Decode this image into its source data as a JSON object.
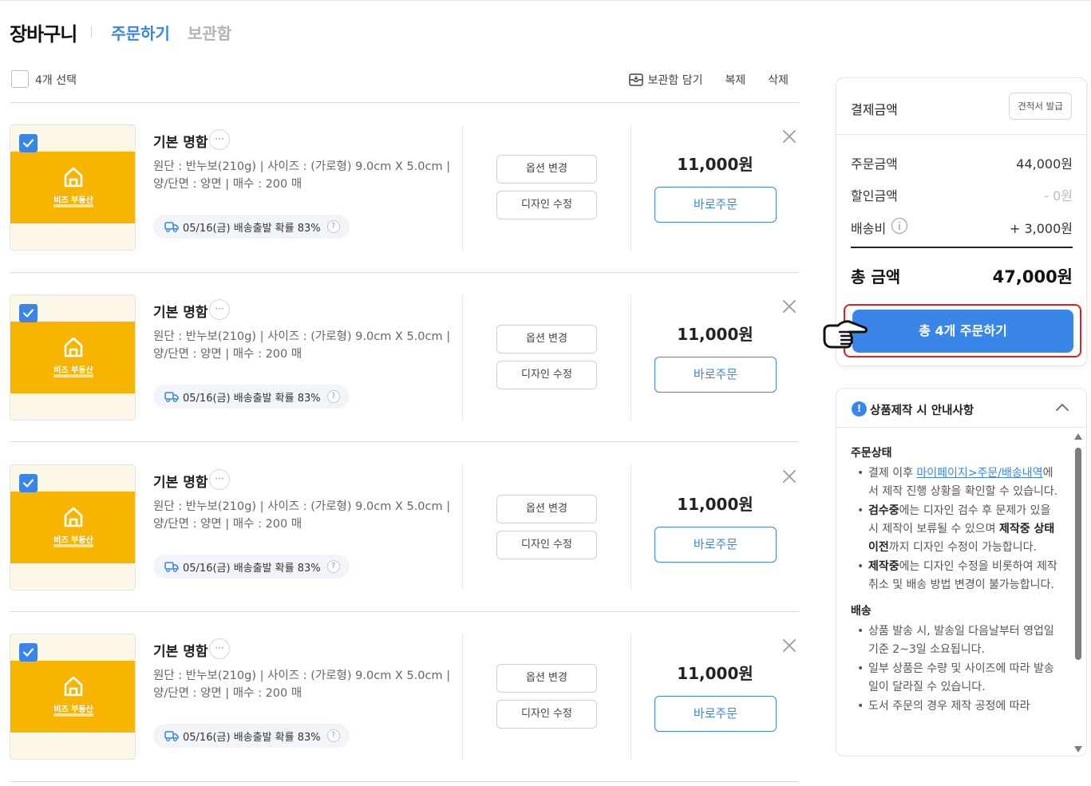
{
  "header": {
    "title": "장바구니",
    "tab_order": "주문하기",
    "tab_archive": "보관함"
  },
  "select_bar": {
    "select_label": "4개 선택",
    "archive_label": "보관함 담기",
    "duplicate_label": "복제",
    "delete_label": "삭제"
  },
  "items": [
    {
      "name": "기본 명함",
      "spec_line1": "원단 : 반누보(210g) | 사이즈 : (가로형) 9.0cm X 5.0cm |",
      "spec_line2": "양/단면 : 양면 | 매수 : 200 매",
      "shipping": "05/16(금) 배송출발 확률 83%",
      "option_label": "옵션 변경",
      "design_label": "디자인 수정",
      "price": "11,000원",
      "buy_label": "바로주문",
      "thumb_text": "비즈 부동산",
      "checked": true
    },
    {
      "name": "기본 명함",
      "spec_line1": "원단 : 반누보(210g) | 사이즈 : (가로형) 9.0cm X 5.0cm |",
      "spec_line2": "양/단면 : 양면 | 매수 : 200 매",
      "shipping": "05/16(금) 배송출발 확률 83%",
      "option_label": "옵션 변경",
      "design_label": "디자인 수정",
      "price": "11,000원",
      "buy_label": "바로주문",
      "thumb_text": "비즈 부동산",
      "checked": true
    },
    {
      "name": "기본 명함",
      "spec_line1": "원단 : 반누보(210g) | 사이즈 : (가로형) 9.0cm X 5.0cm |",
      "spec_line2": "양/단면 : 양면 | 매수 : 200 매",
      "shipping": "05/16(금) 배송출발 확률 83%",
      "option_label": "옵션 변경",
      "design_label": "디자인 수정",
      "price": "11,000원",
      "buy_label": "바로주문",
      "thumb_text": "비즈 부동산",
      "checked": true
    },
    {
      "name": "기본 명함",
      "spec_line1": "원단 : 반누보(210g) | 사이즈 : (가로형) 9.0cm X 5.0cm |",
      "spec_line2": "양/단면 : 양면 | 매수 : 200 매",
      "shipping": "05/16(금) 배송출발 확률 83%",
      "option_label": "옵션 변경",
      "design_label": "디자인 수정",
      "price": "11,000원",
      "buy_label": "바로주문",
      "thumb_text": "비즈 부동산",
      "checked": true
    }
  ],
  "summary": {
    "title": "결제금액",
    "quote_label": "견적서 발급",
    "order_amount_label": "주문금액",
    "order_amount": "44,000원",
    "discount_label": "할인금액",
    "discount": "- 0원",
    "shipping_label": "배송비",
    "shipping": "+ 3,000원",
    "total_label": "총 금액",
    "total": "47,000원",
    "order_button": "총 4개 주문하기"
  },
  "notice": {
    "title": "상품제작 시 안내사항",
    "sec1_title": "주문상태",
    "sec1_b1_pre": "결제 이후 ",
    "sec1_b1_link": "마이페이지>주문/배송내역",
    "sec1_b1_post": "에서 제작 진행 상황을 확인할 수 있습니다.",
    "sec1_b2_bold1": "검수중",
    "sec1_b2_mid": "에는 디자인 검수 후 문제가 있을 시 제작이 보류될 수 있으며 ",
    "sec1_b2_bold2": "제작중 상태 이전",
    "sec1_b2_post": "까지 디자인 수정이 가능합니다.",
    "sec1_b3_bold": "제작중",
    "sec1_b3_post": "에는 디자인 수정을 비롯하여 제작 취소 및 배송 방법 변경이 불가능합니다.",
    "sec2_title": "배송",
    "sec2_b1": "상품 발송 시, 발송일 다음날부터 영업일 기준 2~3일 소요됩니다.",
    "sec2_b2": "일부 상품은 수량 및 사이즈에 따라 발송일이 달라질 수 있습니다.",
    "sec2_b3": "도서 주문의 경우 제작 공정에 따라"
  },
  "colors": {
    "accent": "#3a86e8",
    "highlight_border": "#e02020",
    "thumb_card": "#f7b400"
  }
}
